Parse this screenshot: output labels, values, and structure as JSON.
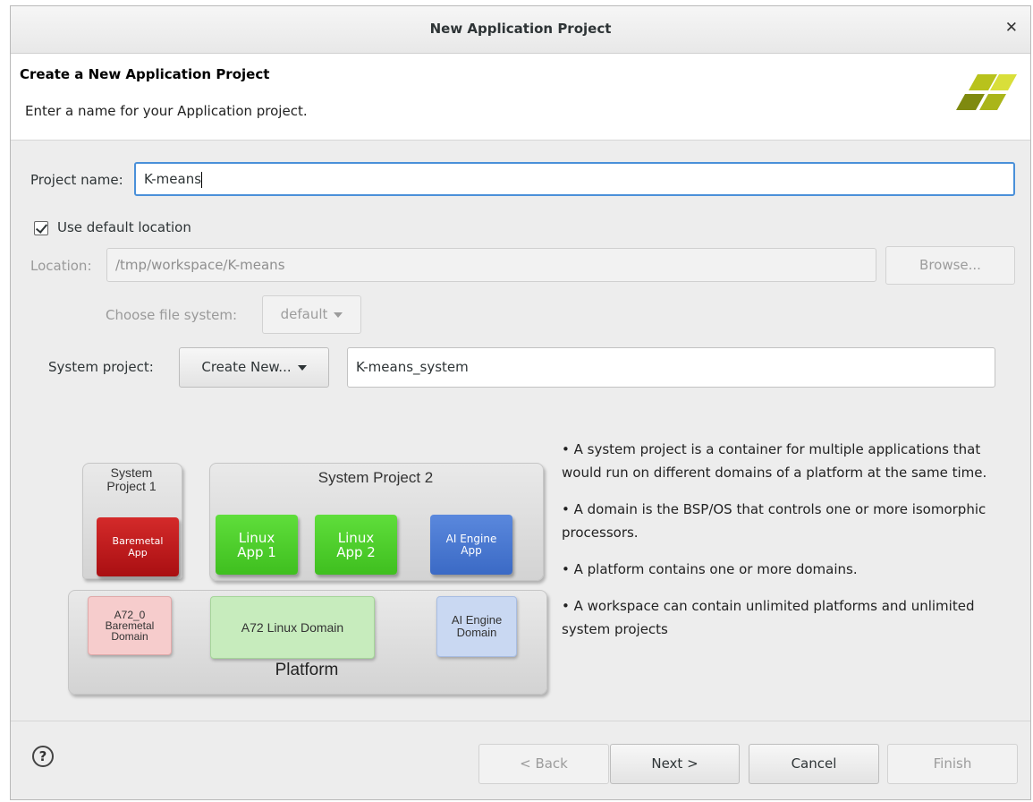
{
  "window": {
    "title": "New Application Project"
  },
  "header": {
    "title": "Create a New Application Project",
    "subtitle": "Enter a name for your Application project."
  },
  "form": {
    "project_name_label": "Project name:",
    "project_name_value": "K-means",
    "use_default_location_label": "Use default location",
    "use_default_location_checked": true,
    "location_label": "Location:",
    "location_value": "/tmp/workspace/K-means",
    "browse_label": "Browse...",
    "file_system_label": "Choose file system:",
    "file_system_value": "default",
    "system_project_label": "System project:",
    "system_project_mode": "Create New...",
    "system_project_name": "K-means_system"
  },
  "diagram": {
    "system_project_1": "System\nProject 1",
    "system_project_2": "System Project 2",
    "baremetal_app": "Baremetal\nApp",
    "linux_app_1": "Linux\nApp 1",
    "linux_app_2": "Linux\nApp 2",
    "ai_engine_app": "AI Engine\nApp",
    "a72_baremetal_domain": "A72_0\nBaremetal\nDomain",
    "a72_linux_domain": "A72 Linux Domain",
    "ai_engine_domain": "AI Engine\nDomain",
    "platform": "Platform"
  },
  "info_bullets": [
    "• A system project is a container for multiple applications that would run on different domains of a platform at the same time.",
    "• A domain is the BSP/OS that controls one or more isomorphic processors.",
    "• A platform contains one or more domains.",
    "• A workspace can contain unlimited platforms and unlimited system projects"
  ],
  "footer": {
    "back_label": "< Back",
    "next_label": "Next >",
    "cancel_label": "Cancel",
    "finish_label": "Finish"
  },
  "colors": {
    "focus_border": "#4a90d9",
    "baremetal_app": "#c4161c",
    "linux_app": "#52d02f",
    "ai_engine_app": "#4a78d1",
    "baremetal_domain": "#f5c8c8",
    "linux_domain": "#c7ecbd",
    "ai_domain": "#c9d8f2"
  },
  "icons": {
    "close": "close-icon",
    "help": "help-icon",
    "logo": "xilinx-logo"
  }
}
